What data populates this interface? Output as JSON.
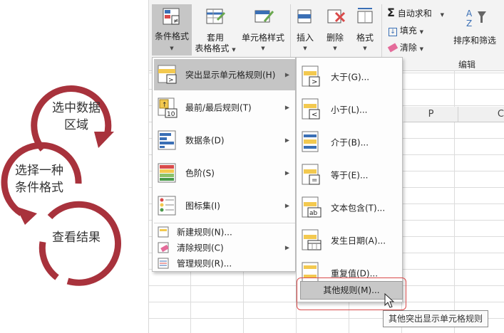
{
  "diagram": {
    "steps": [
      "选中数据\n区域",
      "选择一种\n条件格式",
      "查看结果"
    ],
    "color": "#a8323c"
  },
  "ribbon": {
    "conditional_format": "条件格式",
    "table_format_line1": "套用",
    "table_format_line2": "表格格式",
    "cell_style": "单元格样式",
    "insert": "插入",
    "delete": "删除",
    "format": "格式",
    "autosum": "自动求和",
    "fill": "填充",
    "clear": "清除",
    "sort_filter": "排序和筛选",
    "edit_group": "编辑"
  },
  "sheet": {
    "columns": [
      "P",
      "C"
    ]
  },
  "main_menu": {
    "items": [
      {
        "label": "突出显示单元格规则(H)",
        "arrow": true
      },
      {
        "label": "最前/最后规则(T)",
        "arrow": true
      },
      {
        "label": "数据条(D)",
        "arrow": true
      },
      {
        "label": "色阶(S)",
        "arrow": true
      },
      {
        "label": "图标集(I)",
        "arrow": true
      }
    ],
    "small_items": [
      {
        "label": "新建规则(N)..."
      },
      {
        "label": "清除规则(C)",
        "arrow": true
      },
      {
        "label": "管理规则(R)..."
      }
    ]
  },
  "sub_menu": {
    "items": [
      {
        "label": "大于(G)..."
      },
      {
        "label": "小于(L)..."
      },
      {
        "label": "介于(B)..."
      },
      {
        "label": "等于(E)..."
      },
      {
        "label": "文本包含(T)..."
      },
      {
        "label": "发生日期(A)..."
      },
      {
        "label": "重复值(D)..."
      }
    ],
    "more_rules": "其他规则(M)..."
  },
  "tooltip": "其他突出显示单元格规则",
  "colors": {
    "highlight": "#c5c5c5",
    "accent_red": "#d94a4a",
    "icon_yellow": "#f3c94f",
    "icon_blue": "#3a6fb5"
  }
}
